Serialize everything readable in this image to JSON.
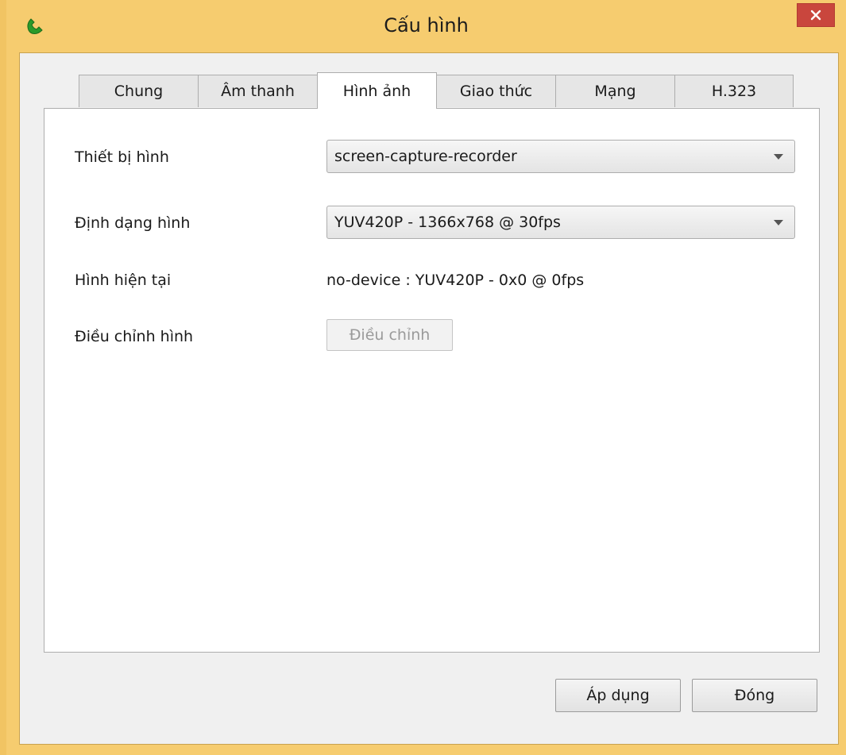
{
  "window": {
    "title": "Cấu hình",
    "icon": "phone-icon",
    "close_icon": "close-icon",
    "accent": "#f6cc6f",
    "close_color": "#c9463d"
  },
  "tabs": [
    {
      "label": "Chung",
      "active": false
    },
    {
      "label": "Âm thanh",
      "active": false
    },
    {
      "label": "Hình ảnh",
      "active": true
    },
    {
      "label": "Giao thức",
      "active": false
    },
    {
      "label": "Mạng",
      "active": false
    },
    {
      "label": "H.323",
      "active": false
    }
  ],
  "video": {
    "device_label": "Thiết bị hình",
    "device_value": "screen-capture-recorder",
    "format_label": "Định dạng hình",
    "format_value": "YUV420P - 1366x768 @ 30fps",
    "current_label": "Hình hiện tại",
    "current_value": "no-device : YUV420P - 0x0 @ 0fps",
    "adjust_label": "Điều chỉnh hình",
    "adjust_button": "Điều chỉnh"
  },
  "footer": {
    "apply_label": "Áp dụng",
    "close_label": "Đóng"
  }
}
